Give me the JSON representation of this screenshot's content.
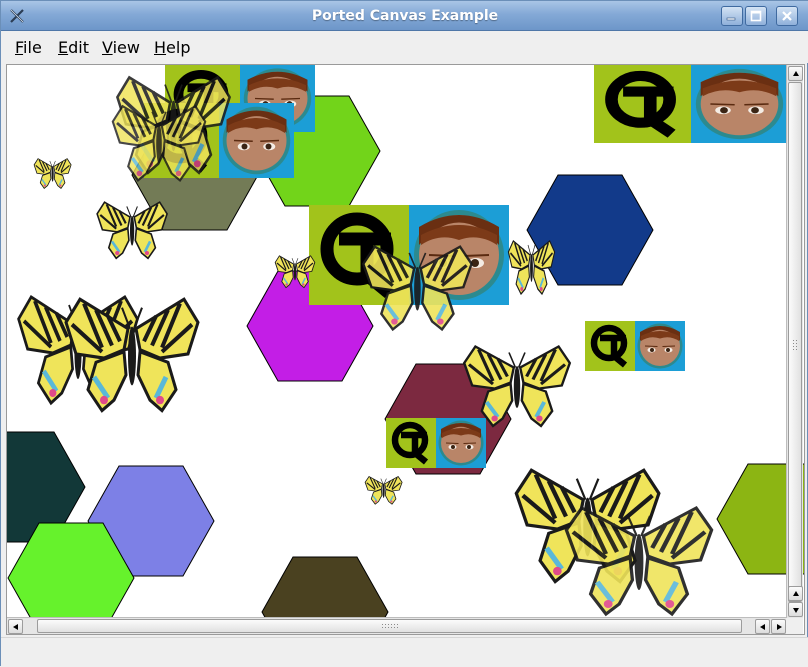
{
  "window": {
    "title": "Ported Canvas Example"
  },
  "menubar": {
    "items": [
      {
        "label_first": "F",
        "label_rest": "ile"
      },
      {
        "label_first": "E",
        "label_rest": "dit"
      },
      {
        "label_first": "V",
        "label_rest": "iew"
      },
      {
        "label_first": "H",
        "label_rest": "elp"
      }
    ]
  },
  "canvas": {
    "sprites": [
      "qt-logo-with-child-photo",
      "butterfly",
      "hexagon"
    ],
    "colors": {
      "hex_green": "#72d41a",
      "hex_olive": "#737b56",
      "hex_navy": "#123a8a",
      "hex_magenta": "#c31ee6",
      "hex_maroon": "#7c2940",
      "hex_darkteal": "#123838",
      "hex_periwinkle": "#7d80e6",
      "hex_lime": "#66f22c",
      "hex_darkolive": "#4a4120",
      "hex_yellowgreen": "#8cb513",
      "qt_logo_bg": "#a2c31b",
      "photo_bg": "#1c9ed6"
    }
  },
  "icons": {
    "app": "app-x-icon",
    "minimize": "minimize-icon",
    "maximize": "maximize-icon",
    "close": "close-icon"
  }
}
